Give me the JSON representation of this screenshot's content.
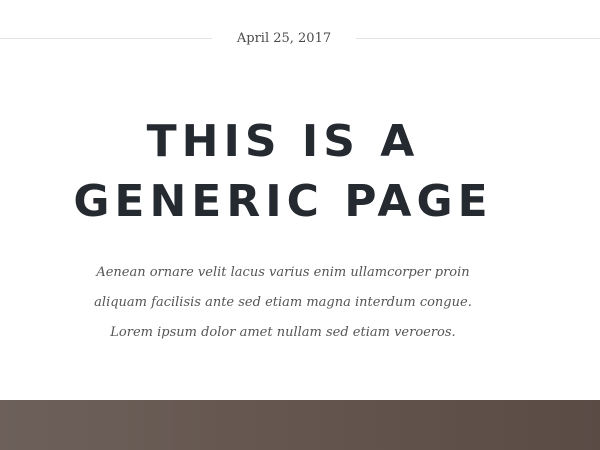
{
  "post": {
    "date": "April 25, 2017",
    "title_line1": "THIS IS A",
    "title_line2": "GENERIC PAGE",
    "intro": "Aenean ornare velit lacus varius enim ullamcorper proin aliquam facilisis ante sed etiam magna interdum congue. Lorem ipsum dolor amet nullam sed etiam veroeros."
  },
  "colors": {
    "heading": "#252a31",
    "body_text": "#555555",
    "divider": "#e4e4e4",
    "banner": "#65574f"
  }
}
